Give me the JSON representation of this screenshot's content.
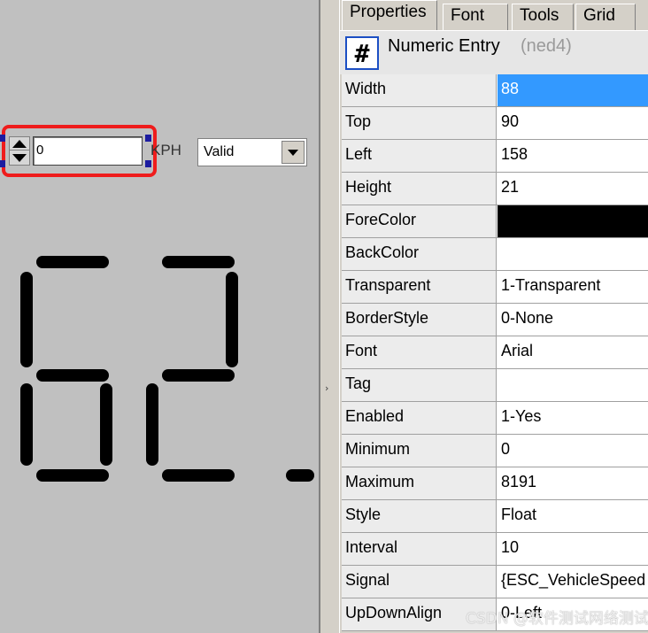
{
  "canvas": {
    "numeric_entry_value": "0",
    "unit_label": "KPH",
    "status_select": "Valid",
    "lcd_digits": [
      "6",
      "2"
    ],
    "lcd_decimal_point": true
  },
  "panel": {
    "tabs": [
      {
        "label": "Properties",
        "active": true
      },
      {
        "label": "Font",
        "active": false
      },
      {
        "label": "Tools",
        "active": false
      },
      {
        "label": "Grid",
        "active": false
      }
    ],
    "object": {
      "icon": "hash-icon",
      "name": "Numeric Entry",
      "id": "(ned4)"
    },
    "properties": [
      {
        "name": "Width",
        "value": "88",
        "selected": true
      },
      {
        "name": "Top",
        "value": "90"
      },
      {
        "name": "Left",
        "value": "158"
      },
      {
        "name": "Height",
        "value": "21"
      },
      {
        "name": "ForeColor",
        "value": "",
        "swatch": "#000000"
      },
      {
        "name": "BackColor",
        "value": ""
      },
      {
        "name": "Transparent",
        "value": "1-Transparent"
      },
      {
        "name": "BorderStyle",
        "value": "0-None"
      },
      {
        "name": "Font",
        "value": "Arial"
      },
      {
        "name": "Tag",
        "value": ""
      },
      {
        "name": "Enabled",
        "value": "1-Yes"
      },
      {
        "name": "Minimum",
        "value": "0"
      },
      {
        "name": "Maximum",
        "value": "8191"
      },
      {
        "name": "Style",
        "value": "Float"
      },
      {
        "name": "Interval",
        "value": "10"
      },
      {
        "name": "Signal",
        "value": "{ESC_VehicleSpeed"
      },
      {
        "name": "UpDownAlign",
        "value": "0-Left"
      }
    ]
  },
  "watermark": "CSDN @软件测试网络测试",
  "colors": {
    "selection_frame": "#ef1c1c",
    "selection_handles": "#1c1ca0",
    "selected_cell": "#3399ff"
  }
}
